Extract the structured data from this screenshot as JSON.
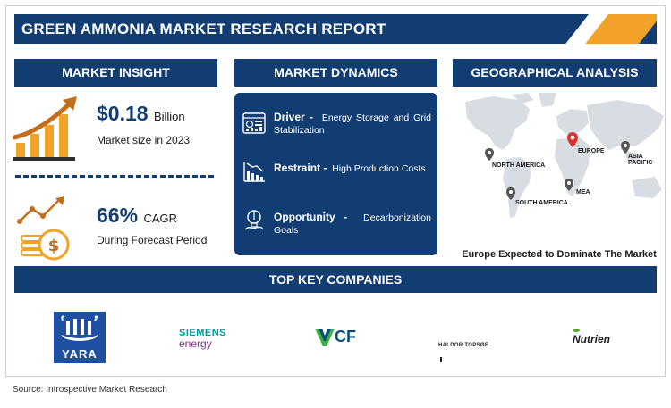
{
  "header": {
    "title": "GREEN AMMONIA MARKET RESEARCH REPORT"
  },
  "market_insight": {
    "heading": "MARKET INSIGHT",
    "size_value": "$0.18",
    "size_unit": "Billion",
    "size_label": "Market size in 2023",
    "cagr_value": "66%",
    "cagr_unit": "CAGR",
    "cagr_label": "During Forecast Period"
  },
  "market_dynamics": {
    "heading": "MARKET DYNAMICS",
    "items": [
      {
        "key": "Driver -",
        "text": "Energy Storage and Grid Stabilization",
        "icon": "dashboard-icon"
      },
      {
        "key": "Restraint -",
        "text": "High Production Costs",
        "icon": "declining-chart-icon"
      },
      {
        "key": "Opportunity -",
        "text": "Decarbonization Goals",
        "icon": "idea-icon"
      }
    ]
  },
  "geographical_analysis": {
    "heading": "GEOGRAPHICAL ANALYSIS",
    "regions": [
      "NORTH AMERICA",
      "EUROPE",
      "ASIA PACIFIC",
      "MEA",
      "SOUTH AMERICA"
    ],
    "highlight": "EUROPE",
    "caption": "Europe Expected to Dominate The Market"
  },
  "companies": {
    "heading": "TOP KEY COMPANIES",
    "logos": [
      {
        "name": "YARA",
        "color": "#1f4fa0"
      },
      {
        "name_top": "SIEMENS",
        "name_bottom": "energy",
        "color": "#009999",
        "color2": "#8a2b8c"
      },
      {
        "name": "CF",
        "color": "#0a4c7a",
        "accent": "#3cb043"
      },
      {
        "name": "HALDOR TOPSØE",
        "color": "#222222"
      },
      {
        "name": "Nutrien",
        "color": "#1a1a1a",
        "accent": "#5aa631"
      }
    ]
  },
  "footer": {
    "source": "Source: Introspective Market Research"
  },
  "colors": {
    "navy": "#123d73",
    "orange": "#f2a228",
    "marker_red": "#d9322b",
    "marker_gray": "#555555"
  }
}
